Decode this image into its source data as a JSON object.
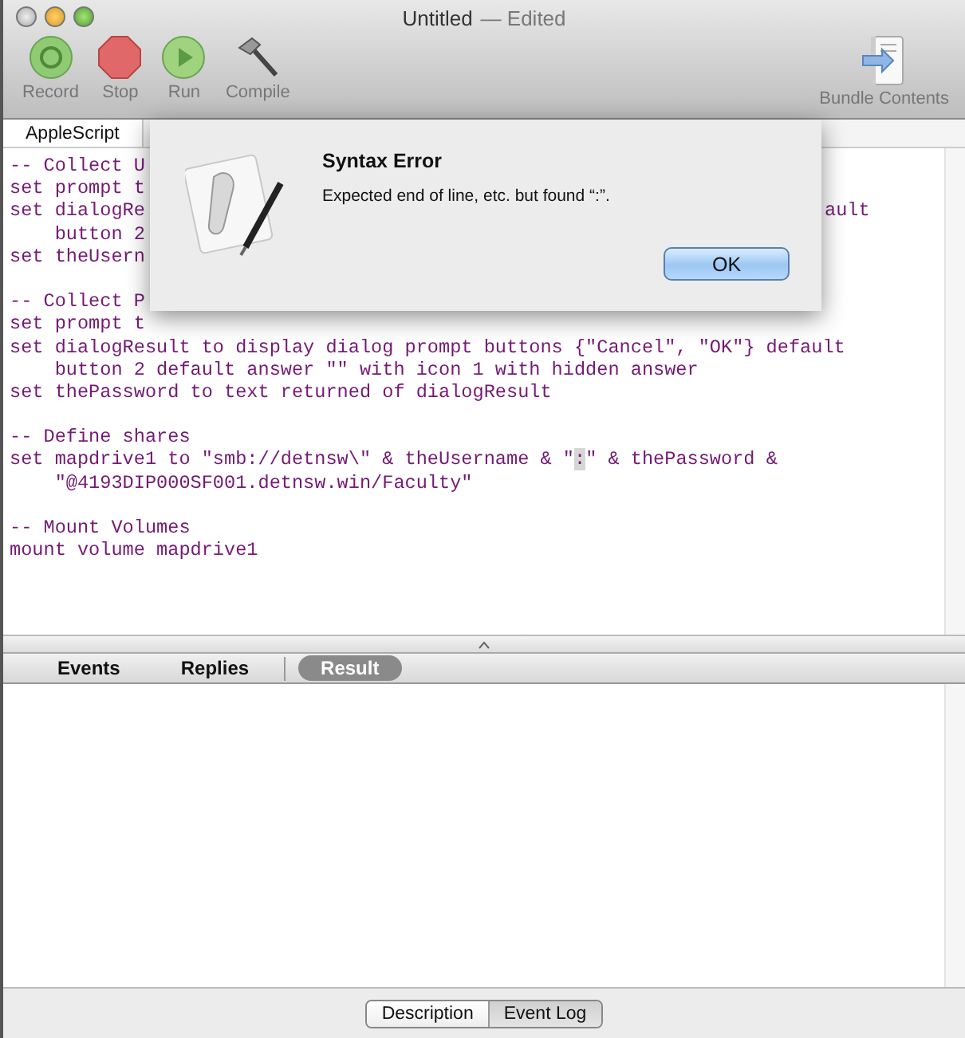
{
  "window": {
    "title": "Untitled",
    "edited": "— Edited"
  },
  "toolbar": {
    "left": [
      {
        "label": "Record",
        "kind": "record"
      },
      {
        "label": "Stop",
        "kind": "stop"
      },
      {
        "label": "Run",
        "kind": "run"
      },
      {
        "label": "Compile",
        "kind": "compile"
      }
    ],
    "right": [
      {
        "label": "Bundle Contents",
        "kind": "bundle"
      }
    ]
  },
  "navigation_bar": {
    "language": "AppleScript"
  },
  "code_lines": [
    {
      "kind": "code",
      "text": "-- Collect U"
    },
    {
      "kind": "code",
      "text": "set prompt t"
    },
    {
      "kind": "code",
      "text": "set dialogRe",
      "tail": "ault"
    },
    {
      "kind": "code",
      "text": "    button 2"
    },
    {
      "kind": "code",
      "text": "set theUsern"
    },
    {
      "kind": "blank"
    },
    {
      "kind": "code",
      "text": "-- Collect P"
    },
    {
      "kind": "code",
      "text": "set prompt t"
    },
    {
      "kind": "code",
      "text": "set dialogResult to display dialog prompt buttons {\"Cancel\", \"OK\"} default"
    },
    {
      "kind": "code",
      "text": "    button 2 default answer \"\" with icon 1 with hidden answer"
    },
    {
      "kind": "code",
      "text": "set thePassword to text returned of dialogResult"
    },
    {
      "kind": "blank"
    },
    {
      "kind": "code",
      "text": "-- Define shares"
    },
    {
      "kind": "code",
      "text": "set mapdrive1 to \"smb://detnsw\\\" & theUsername & \"",
      "selection": ":",
      "after": "\" & thePassword &"
    },
    {
      "kind": "code",
      "text": "    \"@4193DIP000SF001.detnsw.win/Faculty\""
    },
    {
      "kind": "blank"
    },
    {
      "kind": "code",
      "text": "-- Mount Volumes"
    },
    {
      "kind": "code",
      "text": "mount volume mapdrive1"
    }
  ],
  "result_tabs": [
    {
      "label": "Events",
      "selected": false
    },
    {
      "label": "Replies",
      "selected": false
    },
    {
      "label": "Result",
      "selected": true
    }
  ],
  "bottom_segments": [
    {
      "label": "Description",
      "selected": false
    },
    {
      "label": "Event Log",
      "selected": true
    }
  ],
  "dialog": {
    "title": "Syntax Error",
    "message": "Expected end of line, etc. but found “:”.",
    "button": "OK"
  }
}
